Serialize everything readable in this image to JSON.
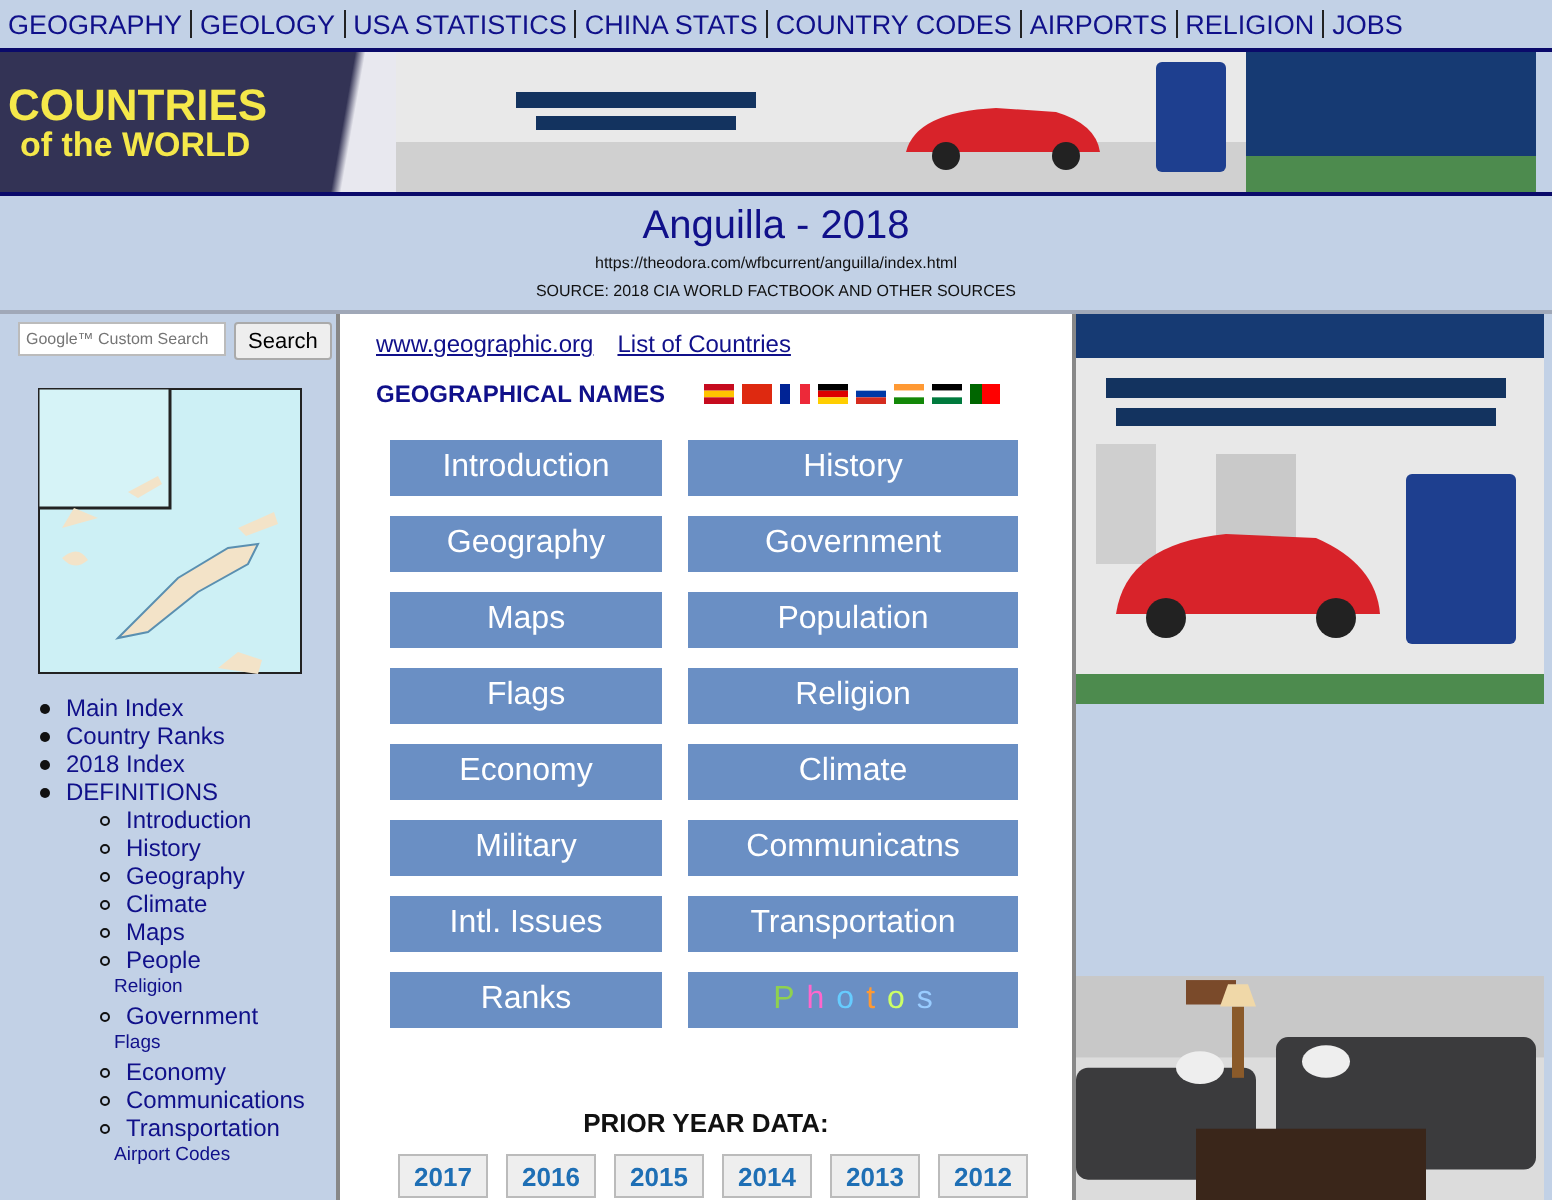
{
  "top_nav": [
    "GEOGRAPHY",
    "GEOLOGY",
    "USA STATISTICS",
    "CHINA STATS",
    "COUNTRY CODES",
    "AIRPORTS",
    "RELIGION",
    "JOBS"
  ],
  "logo": {
    "line1": "COUNTRIES",
    "line2": "of the WORLD"
  },
  "header": {
    "title": "Anguilla - 2018",
    "url": "https://theodora.com/wfbcurrent/anguilla/index.html",
    "source": "SOURCE: 2018 CIA WORLD FACTBOOK AND OTHER SOURCES"
  },
  "search": {
    "placeholder": "Google™ Custom Search",
    "button": "Search"
  },
  "sidebar": {
    "items": [
      {
        "label": "Main Index"
      },
      {
        "label": "Country Ranks"
      },
      {
        "label": "2018 Index"
      },
      {
        "label": "DEFINITIONS",
        "children": [
          {
            "label": "Introduction"
          },
          {
            "label": "History"
          },
          {
            "label": "Geography"
          },
          {
            "label": "Climate"
          },
          {
            "label": "Maps"
          },
          {
            "label": "People",
            "children": [
              {
                "label": "Religion"
              }
            ]
          },
          {
            "label": "Government",
            "children": [
              {
                "label": "Flags"
              }
            ]
          },
          {
            "label": "Economy"
          },
          {
            "label": "Communications"
          },
          {
            "label": "Transportation",
            "children": [
              {
                "label": "Airport Codes"
              }
            ]
          }
        ]
      }
    ]
  },
  "links": [
    "www.geographic.org",
    "List of Countries"
  ],
  "geo_names": "GEOGRAPHICAL NAMES",
  "sections": [
    {
      "kind": "text",
      "label": "Introduction"
    },
    {
      "kind": "text",
      "label": "History"
    },
    {
      "kind": "text",
      "label": "Geography"
    },
    {
      "kind": "text",
      "label": "Government"
    },
    {
      "kind": "text",
      "label": "Maps"
    },
    {
      "kind": "text",
      "label": "Population"
    },
    {
      "kind": "text",
      "label": "Flags"
    },
    {
      "kind": "text",
      "label": "Religion"
    },
    {
      "kind": "text",
      "label": "Economy"
    },
    {
      "kind": "text",
      "label": "Climate"
    },
    {
      "kind": "text",
      "label": "Military"
    },
    {
      "kind": "text",
      "label": "Communicatns"
    },
    {
      "kind": "text",
      "label": "Intl. Issues"
    },
    {
      "kind": "text",
      "label": "Transportation"
    },
    {
      "kind": "text",
      "label": "Ranks"
    },
    {
      "kind": "rainbow",
      "letters": [
        {
          "char": "P",
          "color": "#8fd14f"
        },
        {
          "char": "h",
          "color": "#ff66cc"
        },
        {
          "char": "o",
          "color": "#66ccff"
        },
        {
          "char": "t",
          "color": "#ff9933"
        },
        {
          "char": "o",
          "color": "#ccff66"
        },
        {
          "char": "s",
          "color": "#99ccff"
        }
      ]
    }
  ],
  "prior_years": {
    "heading": "PRIOR YEAR DATA:",
    "years": [
      "2017",
      "2016",
      "2015",
      "2014",
      "2013",
      "2012"
    ]
  }
}
